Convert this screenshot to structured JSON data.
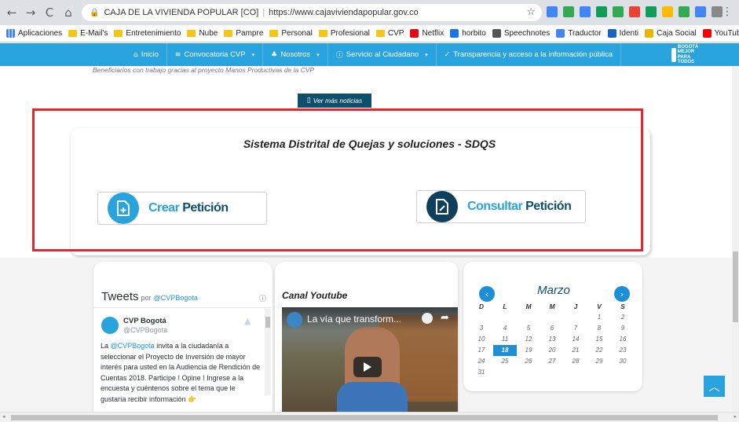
{
  "browser": {
    "nav": {
      "back": "←",
      "forward": "→",
      "reload": "C",
      "home": "⌂"
    },
    "tab_title": "CAJA DE LA VIVIENDA POPULAR [CO]",
    "url": "https://www.cajaviviendapopular.gov.co",
    "star": "☆",
    "menu": "⋮",
    "extension_icons": [
      "#4285f4",
      "#34a853",
      "#4285f4",
      "#0f9d58",
      "#34a853",
      "#ea4335",
      "#0f9d58",
      "#fbbc05",
      "#34a853",
      "#4285f4",
      "#888888"
    ]
  },
  "bookmarks": {
    "apps_label": "Aplicaciones",
    "items": [
      {
        "label": "E-Mail's",
        "type": "folder"
      },
      {
        "label": "Entretenimiento",
        "type": "folder"
      },
      {
        "label": "Nube",
        "type": "folder"
      },
      {
        "label": "Pampre",
        "type": "folder"
      },
      {
        "label": "Personal",
        "type": "folder"
      },
      {
        "label": "Profesional",
        "type": "folder"
      },
      {
        "label": "CVP",
        "type": "folder"
      },
      {
        "label": "Netflix",
        "type": "site",
        "color": "#e50914"
      },
      {
        "label": "horbito",
        "type": "site",
        "color": "#1a73e8"
      },
      {
        "label": "Speechnotes",
        "type": "site",
        "color": "#555555"
      },
      {
        "label": "Traductor",
        "type": "site",
        "color": "#4285f4"
      },
      {
        "label": "Identi",
        "type": "site",
        "color": "#1565c0"
      },
      {
        "label": "Caja Social",
        "type": "site",
        "color": "#e8b800"
      },
      {
        "label": "YouTube",
        "type": "site",
        "color": "#ff0000"
      }
    ],
    "more": "»"
  },
  "site_nav": {
    "items": [
      {
        "label": "Inicio",
        "icon": "home-icon",
        "glyph": "⌂",
        "caret": false
      },
      {
        "label": "Convocatoria CVP",
        "icon": "stack-icon",
        "glyph": "≋",
        "caret": true
      },
      {
        "label": "Nosotros",
        "icon": "people-icon",
        "glyph": "♣",
        "caret": true
      },
      {
        "label": "Servicio al Ciudadano",
        "icon": "info-icon",
        "glyph": "ⓘ",
        "caret": true
      },
      {
        "label": "Transparencia y acceso a la información pública",
        "icon": "check-circle-icon",
        "glyph": "✓",
        "caret": false
      }
    ],
    "logo_text": "BOGOTÁ MEJOR PARA TODOS"
  },
  "news": {
    "line": "Beneficiarios con trabajo gracias al proyecto Manos Productivas de la CVP",
    "ver_mas": "Ver más noticias"
  },
  "sdqs": {
    "title": "Sistema Distrital de Quejas y soluciones - SDQS",
    "crear_a": "Crear",
    "crear_b": " Petición",
    "consultar_a": "Consultar",
    "consultar_b": " Petición"
  },
  "tweets": {
    "heading": "Tweets",
    "por": "por",
    "handle": "@CVPBogota",
    "info": "ⓘ",
    "author_name": "CVP Bogotá",
    "author_handle": "@CVPBogota",
    "text_pre": "La ",
    "text_mention": "@CVPBogota",
    "text_post": " invita a la ciudadanía a seleccionar el Proyecto de Inversión de mayor interés para usted en la Audiencia de Rendición de Cuentas 2018. Participe ! Opine ! Ingrese a la encuesta y cuéntenos sobre el tema que le gustaría recibir información 👉"
  },
  "youtube": {
    "section_title": "Canal Youtube",
    "video_title": "La vía que transform..."
  },
  "calendar": {
    "month": "Marzo",
    "prev": "‹",
    "next": "›",
    "weekdays": [
      "D",
      "L",
      "M",
      "M",
      "J",
      "V",
      "S"
    ],
    "days": [
      "",
      "",
      "",
      "",
      "",
      "1",
      "2",
      "3",
      "4",
      "5",
      "6",
      "7",
      "8",
      "9",
      "10",
      "11",
      "12",
      "13",
      "14",
      "15",
      "16",
      "17",
      "18",
      "19",
      "20",
      "21",
      "22",
      "23",
      "24",
      "25",
      "26",
      "27",
      "28",
      "29",
      "30",
      "31",
      "",
      "",
      "",
      "",
      "",
      ""
    ],
    "today": "18"
  },
  "back_to_top": "︿"
}
